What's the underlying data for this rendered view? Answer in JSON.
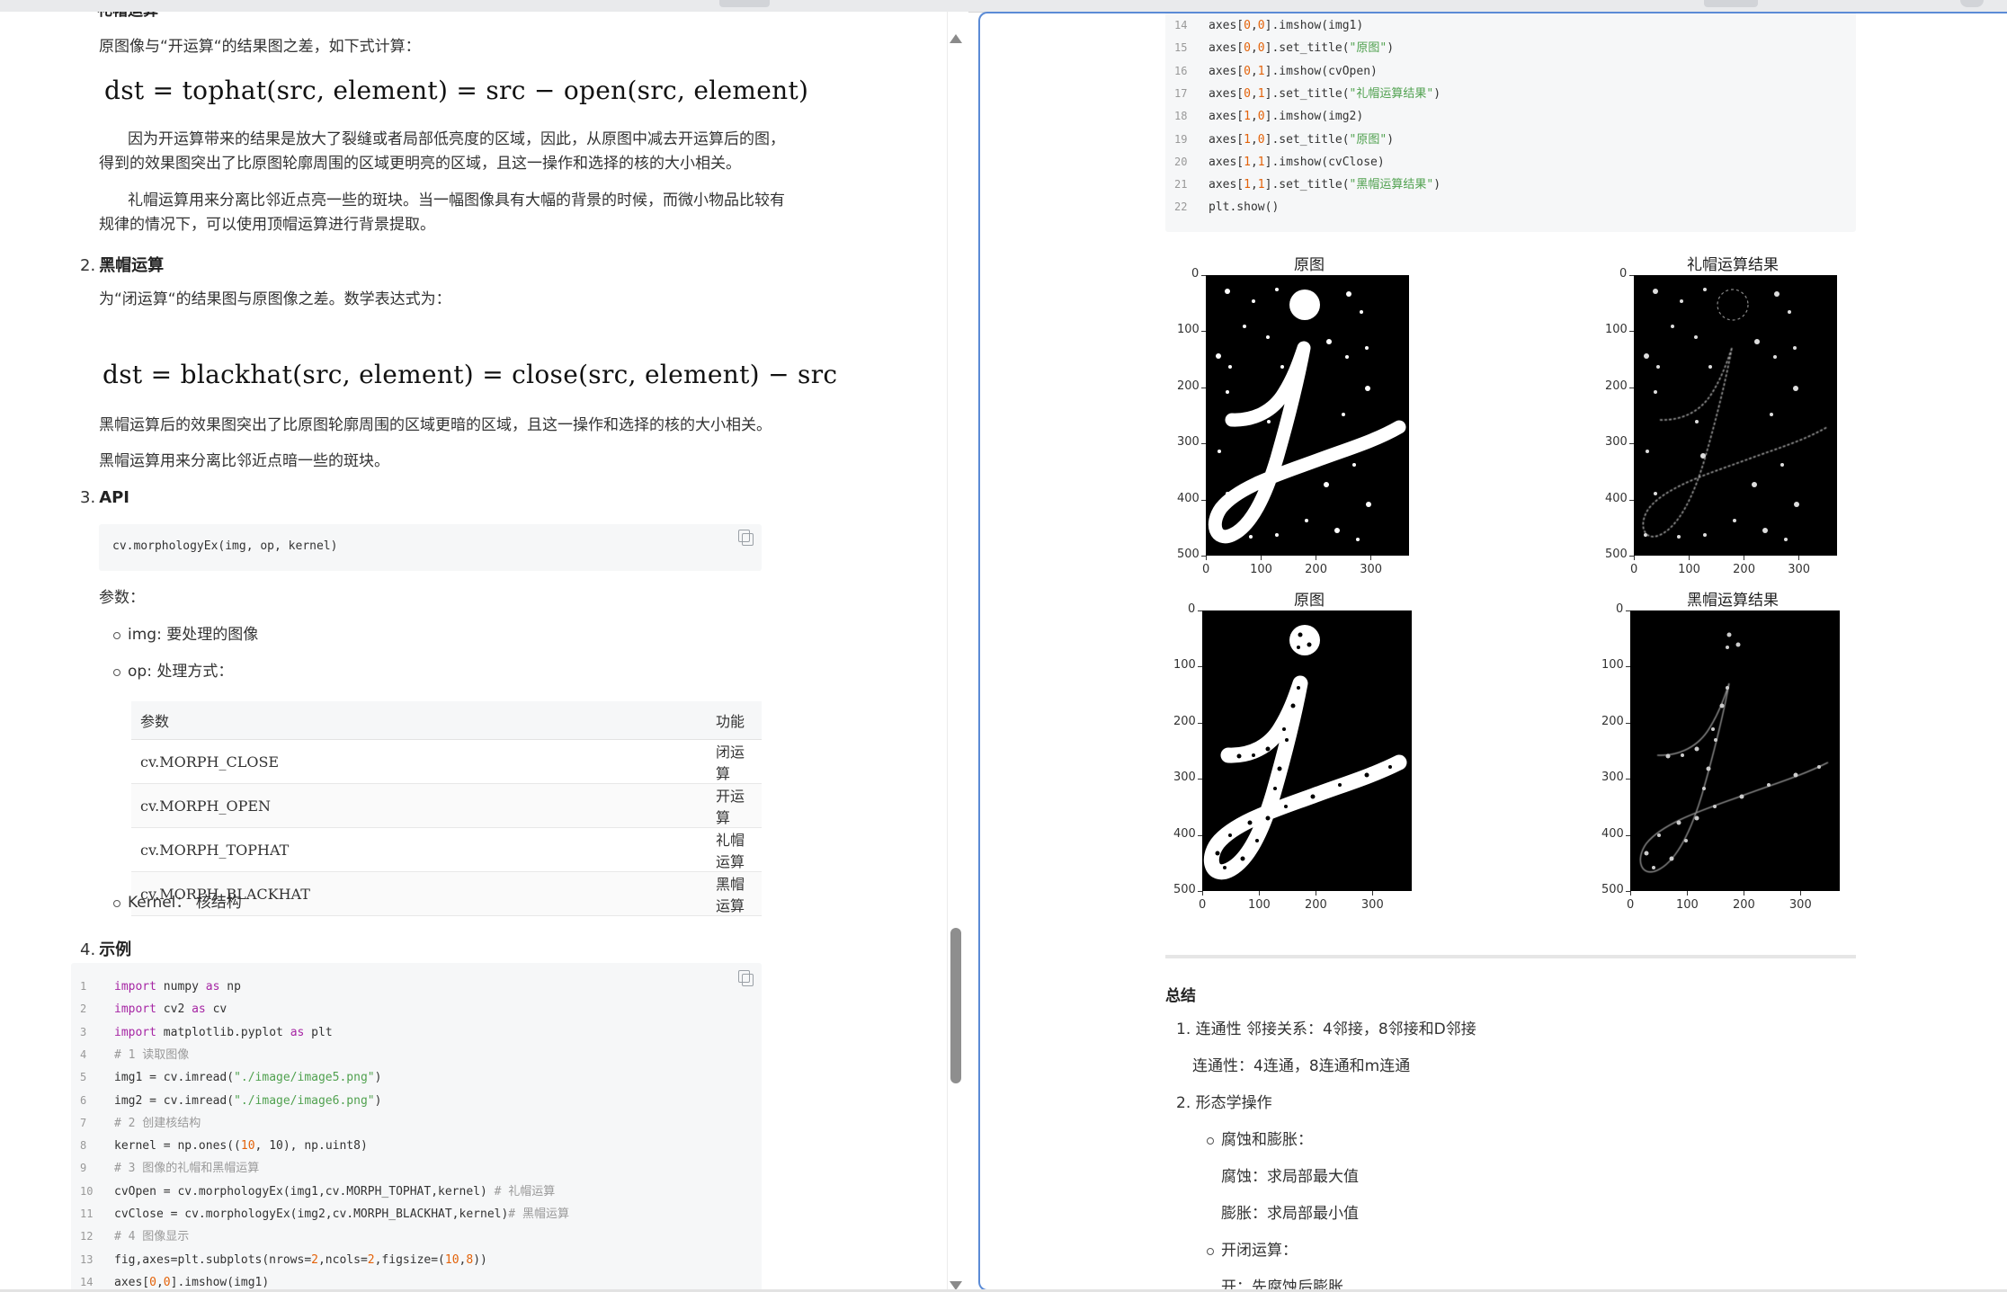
{
  "left": {
    "top_heading_fragment": "礼帽运算",
    "tophat_intro": "原图像与“开运算“的结果图之差，如下式计算：",
    "tophat_formula": "dst = tophat(src, element) = src − open(src, element)",
    "tophat_p1_line1": "因为开运算带来的结果是放大了裂缝或者局部低亮度的区域，因此，从原图中减去开运算后的图，",
    "tophat_p1_line2": "得到的效果图突出了比原图轮廓周围的区域更明亮的区域，且这一操作和选择的核的大小相关。",
    "tophat_p2_line1": "礼帽运算用来分离比邻近点亮一些的斑块。当一幅图像具有大幅的背景的时候，而微小物品比较有",
    "tophat_p2_line2": "规律的情况下，可以使用顶帽运算进行背景提取。",
    "blackhat_num": "2.",
    "blackhat_heading": "黑帽运算",
    "blackhat_intro": "为“闭运算“的结果图与原图像之差。数学表达式为：",
    "blackhat_formula": "dst = blackhat(src, element) = close(src, element) − src",
    "blackhat_p1": "黑帽运算后的效果图突出了比原图轮廓周围的区域更暗的区域，且这一操作和选择的核的大小相关。",
    "blackhat_p2": "黑帽运算用来分离比邻近点暗一些的斑块。",
    "api_num": "3.",
    "api_heading": "API",
    "api_code": "cv.morphologyEx(img, op, kernel)",
    "params_label": "参数：",
    "param_img": "img: 要处理的图像",
    "param_op": "op: 处理方式：",
    "param_kernel": "Kernel： 核结构",
    "table": {
      "headers": [
        "参数",
        "功能"
      ],
      "rows": [
        [
          "cv.MORPH_CLOSE",
          "闭运算"
        ],
        [
          "cv.MORPH_OPEN",
          "开运算"
        ],
        [
          "cv.MORPH_TOPHAT",
          "礼帽运算"
        ],
        [
          "cv.MORPH_BLACKHAT",
          "黑帽运算"
        ]
      ]
    },
    "example_num": "4.",
    "example_heading": "示例",
    "code_lines": [
      {
        "n": "1",
        "t": "import numpy as np"
      },
      {
        "n": "2",
        "t": "import cv2 as cv"
      },
      {
        "n": "3",
        "t": "import matplotlib.pyplot as plt"
      },
      {
        "n": "4",
        "t": "# 1 读取图像"
      },
      {
        "n": "5",
        "t": "img1 = cv.imread(\"./image/image5.png\")"
      },
      {
        "n": "6",
        "t": "img2 = cv.imread(\"./image/image6.png\")"
      },
      {
        "n": "7",
        "t": "# 2 创建核结构"
      },
      {
        "n": "8",
        "t": "kernel = np.ones((10, 10), np.uint8)"
      },
      {
        "n": "9",
        "t": "# 3 图像的礼帽和黑帽运算"
      },
      {
        "n": "10",
        "t": "cvOpen = cv.morphologyEx(img1,cv.MORPH_TOPHAT,kernel) # 礼帽运算"
      },
      {
        "n": "11",
        "t": "cvClose = cv.morphologyEx(img2,cv.MORPH_BLACKHAT,kernel)# 黑帽运算"
      },
      {
        "n": "12",
        "t": "# 4 图像显示"
      },
      {
        "n": "13",
        "t": "fig,axes=plt.subplots(nrows=2,ncols=2,figsize=(10,8))"
      },
      {
        "n": "14",
        "t": "axes[0,0].imshow(img1)"
      }
    ]
  },
  "right": {
    "code_lines": [
      {
        "n": "14",
        "t": "axes[0,0].imshow(img1)"
      },
      {
        "n": "15",
        "t": "axes[0,0].set_title(\"原图\")"
      },
      {
        "n": "16",
        "t": "axes[0,1].imshow(cvOpen)"
      },
      {
        "n": "17",
        "t": "axes[0,1].set_title(\"礼帽运算结果\")"
      },
      {
        "n": "18",
        "t": "axes[1,0].imshow(img2)"
      },
      {
        "n": "19",
        "t": "axes[1,0].set_title(\"原图\")"
      },
      {
        "n": "20",
        "t": "axes[1,1].imshow(cvClose)"
      },
      {
        "n": "21",
        "t": "axes[1,1].set_title(\"黑帽运算结果\")"
      },
      {
        "n": "22",
        "t": "plt.show()"
      }
    ],
    "plot_titles": [
      "原图",
      "礼帽运算结果",
      "原图",
      "黑帽运算结果"
    ],
    "y_ticks": [
      "0",
      "100",
      "200",
      "300",
      "400",
      "500"
    ],
    "x_ticks": [
      "0",
      "100",
      "200",
      "300"
    ],
    "summary_heading": "总结",
    "summary_1": "1. 连通性 邻接关系：4邻接，8邻接和D邻接",
    "summary_1b": "连通性：4连通，8连通和m连通",
    "summary_2": "2. 形态学操作",
    "summary_2a": "腐蚀和膨胀：",
    "summary_2a1": "腐蚀：求局部最大值",
    "summary_2a2": "膨胀：求局部最小值",
    "summary_2b": "开闭运算：",
    "summary_2b1": "开：先腐蚀后膨胀"
  },
  "colors": {
    "focus_border": "#5b8bd6",
    "code_bg": "#f6f7f8",
    "keyword": "#a626a4",
    "string": "#50a14f",
    "number": "#e36209"
  }
}
